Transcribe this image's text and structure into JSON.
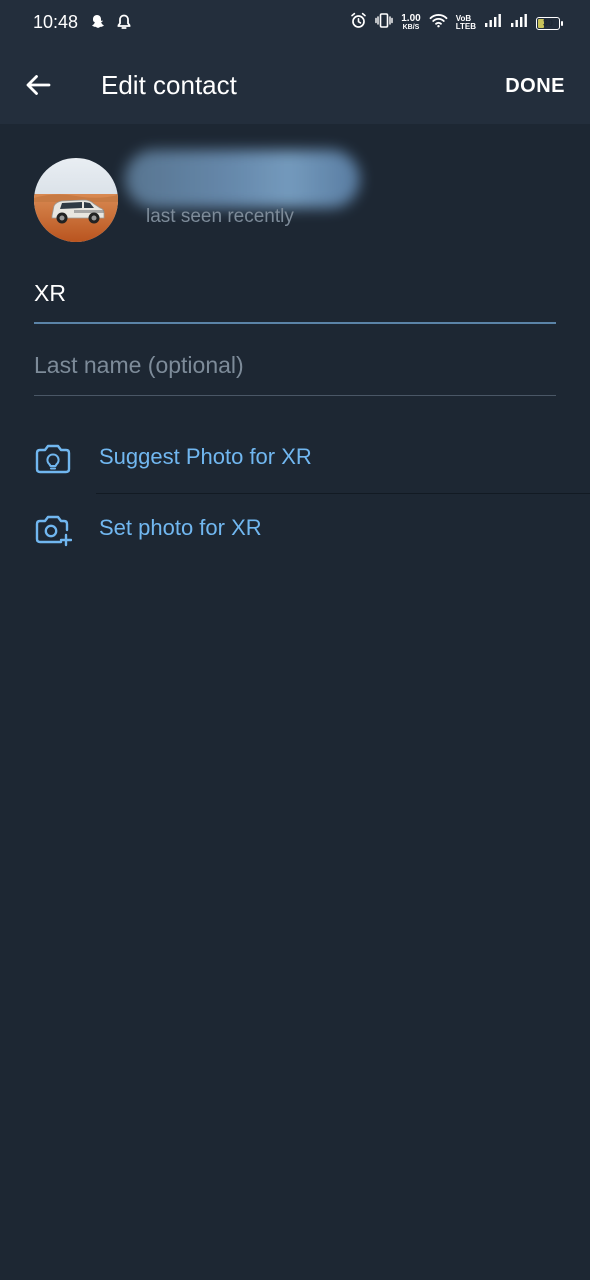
{
  "status_bar": {
    "time": "10:48",
    "net_speed_value": "1.00",
    "net_speed_unit": "KB/S",
    "volte_top": "VoB",
    "volte_bottom": "LTEB",
    "battery_level": "30",
    "icons": [
      "snapchat-icon",
      "notification-bell-icon",
      "alarm-icon",
      "vibrate-icon",
      "wifi-icon",
      "signal-1-icon",
      "signal-2-icon",
      "battery-icon"
    ]
  },
  "app_bar": {
    "title": "Edit contact",
    "done_label": "DONE"
  },
  "profile": {
    "status": "last seen recently"
  },
  "fields": {
    "first_name_value": "XR",
    "last_name_placeholder": "Last name (optional)"
  },
  "actions": {
    "suggest_photo_label": "Suggest Photo for XR",
    "set_photo_label": "Set photo for XR"
  },
  "colors": {
    "background": "#1d2733",
    "header": "#232e3c",
    "accent": "#71b7f0",
    "field_line_active": "#5b84a8",
    "field_line": "#4a5766",
    "secondary_text": "#7d8b99"
  }
}
